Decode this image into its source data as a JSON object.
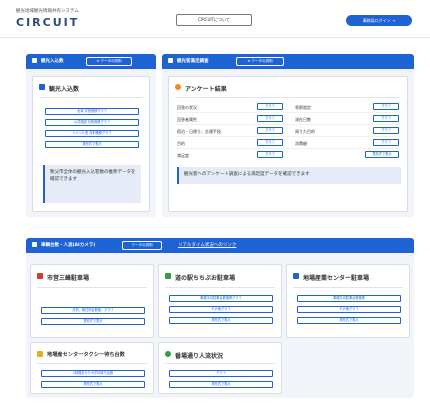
{
  "header": {
    "system_name": "観光地域観光情報共有システム",
    "logo": "CIRCUIT",
    "about_button": "CIRCUITについて",
    "login_button": "事務局ログイン →"
  },
  "colors": {
    "primary": "#1e63d3",
    "panel_bg": "#f1f4f8"
  },
  "tourist_panel": {
    "title": "観光入込数",
    "data_button": "≡ データの説明",
    "card": {
      "title": "観光入込数",
      "buttons": [
        "全体 月別推移グラフ",
        "公共施設 月別推移グラフ",
        "ジャンル別 月別推移グラフ",
        "表形式で表示"
      ],
      "note": "秩父市全体の観光入込客数の推移データを確認できます"
    }
  },
  "survey_panel": {
    "title": "観光客満足調査",
    "data_button": "≡ データの説明",
    "card": {
      "title": "アンケート結果",
      "rows": [
        {
          "left": "回答の状況",
          "left_btn": "グラフ",
          "right": "季節限定",
          "right_btn": "グラフ"
        },
        {
          "left": "回答者属性",
          "left_btn": "グラフ",
          "right": "滞在日数",
          "right_btn": "グラフ"
        },
        {
          "left": "宿泊・日帰り、交通手段",
          "left_btn": "グラフ",
          "right": "周りた目的",
          "right_btn": "グラフ"
        },
        {
          "left": "目的",
          "left_btn": "グラフ",
          "right": "消費額",
          "right_btn": "グラフ"
        },
        {
          "left": "満足度",
          "left_btn": "グラフ",
          "right": "",
          "right_btn": "表形式で表示"
        }
      ],
      "note": "観光客へのアンケート調査による満足度データを確認できます"
    }
  },
  "parking_panel": {
    "title": "車輌台数・人流(AIカメラ)",
    "data_button": "データの説明",
    "realtime_link": "リアルタイム状況へのリンク",
    "cards": [
      {
        "title": "市営三峰駐車場",
        "buttons": [
          "月別、曜日別台数値、グラフ",
          "表形式で表示"
        ]
      },
      {
        "title": "道の駅ちちぶお駐車場",
        "buttons": [
          "車種平均駐車台数推移グラフ",
          "その他グラフ",
          "表形式で表示"
        ]
      },
      {
        "title": "地場産業センター駐車場",
        "buttons": [
          "車種平均駐車台数推移",
          "その他グラフ",
          "表形式で表示"
        ]
      },
      {
        "title": "地場産センタータクシー待ち台数",
        "buttons": [
          "1時間あたりの平均待ち台数",
          "表形式で表示"
        ]
      },
      {
        "title": "番場通り人流状況",
        "buttons": [
          "グラフ",
          "表形式で表示"
        ]
      }
    ]
  }
}
